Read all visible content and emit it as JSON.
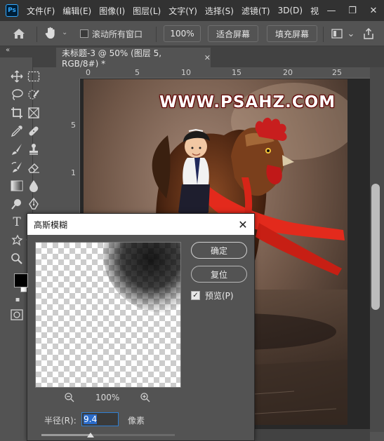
{
  "menubar": {
    "logo": "Ps",
    "items": [
      "文件(F)",
      "编辑(E)",
      "图像(I)",
      "图层(L)",
      "文字(Y)",
      "选择(S)",
      "滤镜(T)",
      "3D(D)",
      "视"
    ],
    "controls": [
      "minimize-icon",
      "restore-icon",
      "close-icon"
    ]
  },
  "options": {
    "scroll_all_windows": "滚动所有窗口",
    "zoom_100": "100%",
    "fit_screen": "适合屏幕",
    "fill_screen": "填充屏幕"
  },
  "document": {
    "tab_title": "未标题-3 @ 50% (图层 5, RGB/8#) *"
  },
  "rulers": {
    "h": [
      "0",
      "5",
      "10",
      "15",
      "20",
      "25"
    ],
    "v": [
      "5",
      "1",
      "1"
    ]
  },
  "canvas": {
    "watermark": "WWW.PSAHZ.COM"
  },
  "dialog": {
    "title": "高斯模糊",
    "ok": "确定",
    "reset": "复位",
    "preview_label": "预览(P)",
    "preview_checked": true,
    "zoom": "100%",
    "radius_label": "半径(R):",
    "radius_value": "9.4",
    "radius_unit": "像素",
    "radius_slider_fraction": 0.37
  },
  "colors": {
    "foreground": "#000000",
    "background": "#ffffff",
    "accent": "#2f7fd3"
  }
}
